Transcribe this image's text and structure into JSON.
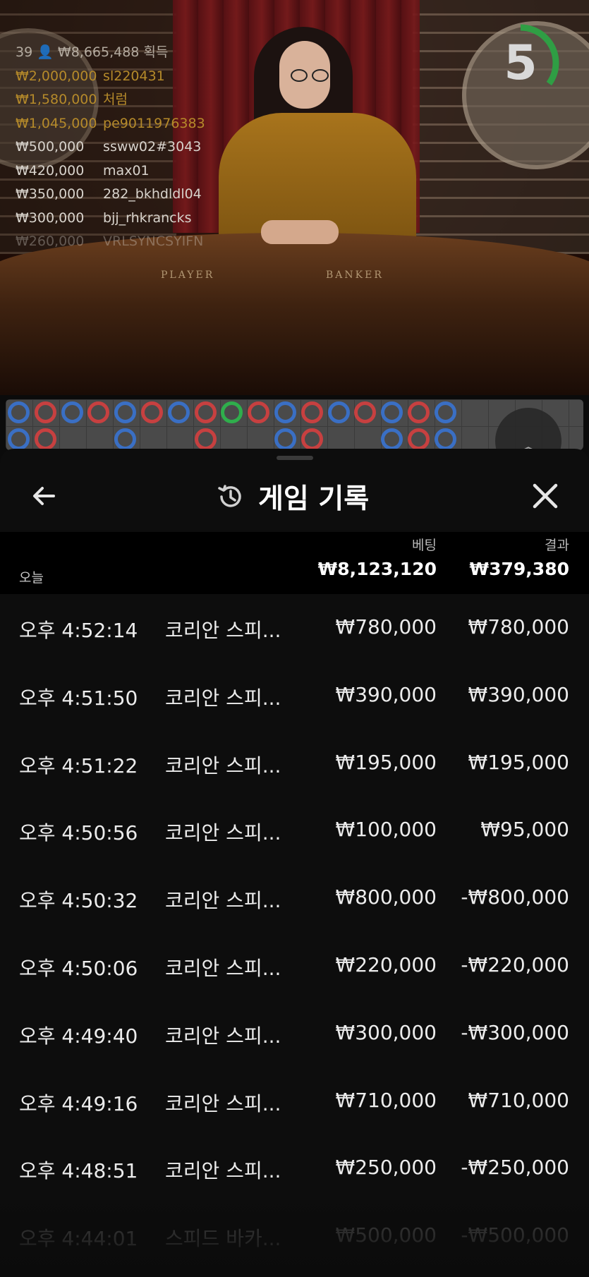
{
  "leaderboard": {
    "header": "39 👤 ₩8,665,488 획득",
    "rows": [
      {
        "amount": "₩2,000,000",
        "name": "sl220431",
        "style": "gold"
      },
      {
        "amount": "₩1,580,000",
        "name": "처럼",
        "style": "gold"
      },
      {
        "amount": "₩1,045,000",
        "name": "pe9011976383",
        "style": "gold"
      },
      {
        "amount": "₩500,000",
        "name": "ssww02#3043",
        "style": "white"
      },
      {
        "amount": "₩420,000",
        "name": "max01",
        "style": "white"
      },
      {
        "amount": "₩350,000",
        "name": "282_bkhdldl04",
        "style": "white"
      },
      {
        "amount": "₩300,000",
        "name": "bjj_rhkrancks",
        "style": "white"
      },
      {
        "amount": "₩260,000",
        "name": "VRLSYNCSYIFN",
        "style": "white"
      }
    ]
  },
  "table": {
    "player_label": "PLAYER",
    "banker_label": "BANKER"
  },
  "timer": {
    "value": "5",
    "progress": 0.35,
    "color": "#2f9e44"
  },
  "roadmap": {
    "row1": [
      "b",
      "r",
      "b",
      "r",
      "b",
      "r",
      "b",
      "r",
      "g",
      "r",
      "b",
      "r",
      "b",
      "r",
      "b",
      "r",
      "b"
    ],
    "row2": [
      "b",
      "r",
      "",
      "",
      "b",
      "",
      "",
      "r",
      "",
      "",
      "b",
      "r",
      "",
      "",
      "b",
      "r",
      "b"
    ]
  },
  "history": {
    "title": "게임 기록",
    "back_icon": "arrow-left-icon",
    "history_icon": "history-clock-icon",
    "close_icon": "close-icon",
    "col_bet": "베팅",
    "col_result": "결과",
    "today_label": "오늘",
    "total_bet": "₩8,123,120",
    "total_result": "₩379,380",
    "rows": [
      {
        "time": "오후 4:52:14",
        "game": "코리안 스피...",
        "bet": "₩780,000",
        "result": "₩780,000"
      },
      {
        "time": "오후 4:51:50",
        "game": "코리안 스피...",
        "bet": "₩390,000",
        "result": "₩390,000"
      },
      {
        "time": "오후 4:51:22",
        "game": "코리안 스피...",
        "bet": "₩195,000",
        "result": "₩195,000"
      },
      {
        "time": "오후 4:50:56",
        "game": "코리안 스피...",
        "bet": "₩100,000",
        "result": "₩95,000"
      },
      {
        "time": "오후 4:50:32",
        "game": "코리안 스피...",
        "bet": "₩800,000",
        "result": "-₩800,000"
      },
      {
        "time": "오후 4:50:06",
        "game": "코리안 스피...",
        "bet": "₩220,000",
        "result": "-₩220,000"
      },
      {
        "time": "오후 4:49:40",
        "game": "코리안 스피...",
        "bet": "₩300,000",
        "result": "-₩300,000"
      },
      {
        "time": "오후 4:49:16",
        "game": "코리안 스피...",
        "bet": "₩710,000",
        "result": "₩710,000"
      },
      {
        "time": "오후 4:48:51",
        "game": "코리안 스피...",
        "bet": "₩250,000",
        "result": "-₩250,000"
      },
      {
        "time": "오후 4:44:01",
        "game": "스피드 바카...",
        "bet": "₩500,000",
        "result": "-₩500,000"
      }
    ]
  }
}
